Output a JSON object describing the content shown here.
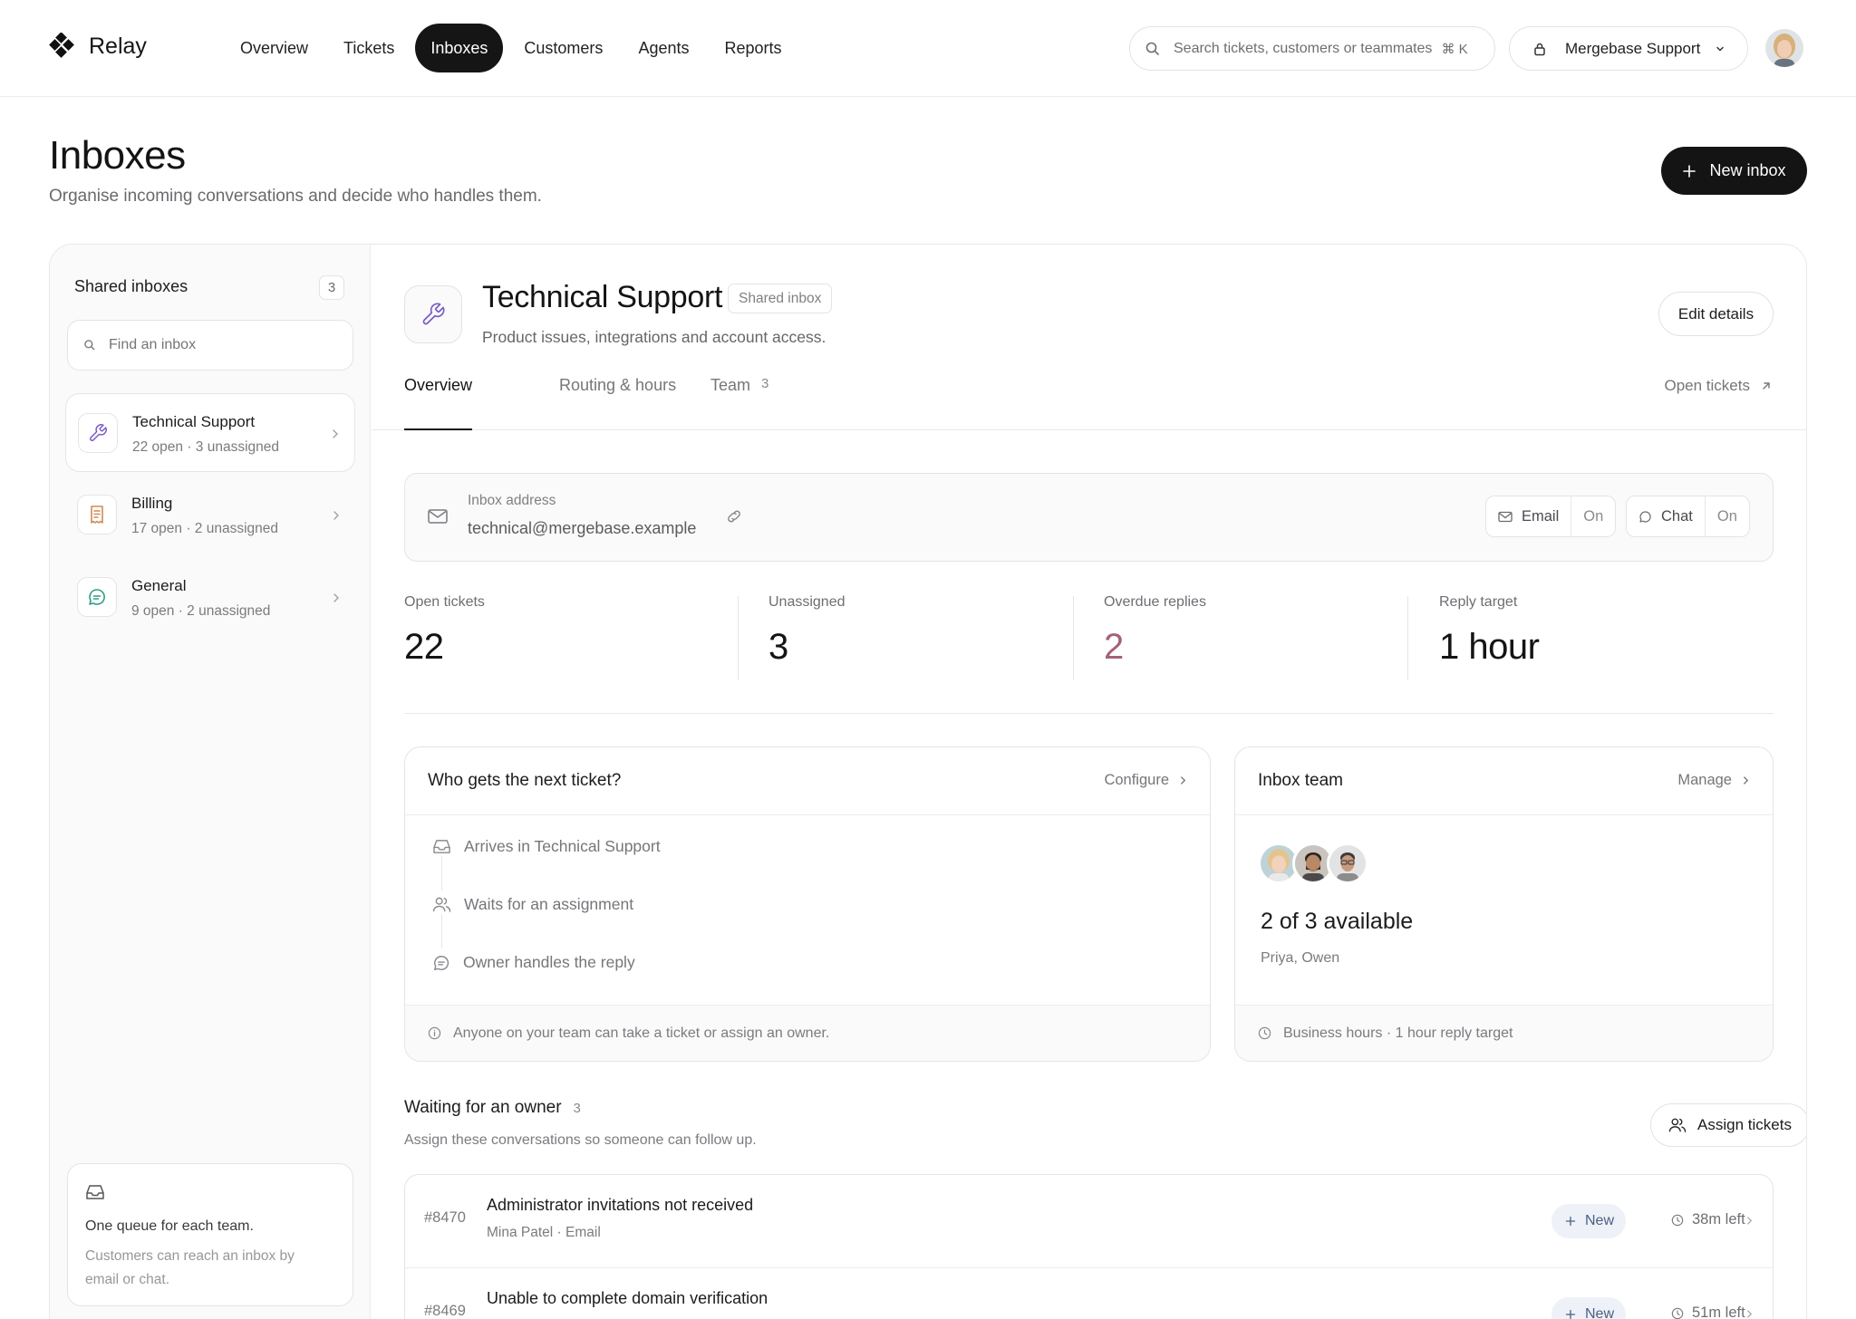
{
  "app": {
    "name": "Relay"
  },
  "nav": {
    "items": [
      {
        "label": "Overview"
      },
      {
        "label": "Tickets"
      },
      {
        "label": "Inboxes",
        "active": true
      },
      {
        "label": "Customers"
      },
      {
        "label": "Agents"
      },
      {
        "label": "Reports"
      }
    ]
  },
  "search": {
    "placeholder": "Search tickets, customers or teammates",
    "shortcut": "⌘ K"
  },
  "workspace": {
    "name": "Mergebase Support"
  },
  "page": {
    "title": "Inboxes",
    "subtitle": "Organise incoming conversations and decide who handles them.",
    "new_button": "New inbox"
  },
  "sidebar": {
    "title": "Shared inboxes",
    "count": "3",
    "search_placeholder": "Find an inbox",
    "items": [
      {
        "name": "Technical Support",
        "meta": "22 open · 3 unassigned",
        "icon": "wrench-icon",
        "selected": true
      },
      {
        "name": "Billing",
        "meta": "17 open · 2 unassigned",
        "icon": "receipt-icon"
      },
      {
        "name": "General",
        "meta": "9 open · 2 unassigned",
        "icon": "chat-bubble-icon"
      }
    ],
    "note": {
      "title": "One queue for each team.",
      "text": "Customers can reach an inbox by email or chat."
    }
  },
  "inbox": {
    "title": "Technical Support",
    "badge": "Shared inbox",
    "description": "Product issues, integrations and account access.",
    "edit_button": "Edit details",
    "tabs": [
      {
        "label": "Overview",
        "active": true
      },
      {
        "label": "Routing & hours"
      },
      {
        "label": "Team",
        "count": "3"
      }
    ],
    "open_tickets_link": "Open tickets",
    "address": {
      "label": "Inbox address",
      "value": "technical@mergebase.example"
    },
    "channels": [
      {
        "name": "Email",
        "state": "On"
      },
      {
        "name": "Chat",
        "state": "On"
      }
    ],
    "stats": [
      {
        "label": "Open tickets",
        "value": "22"
      },
      {
        "label": "Unassigned",
        "value": "3"
      },
      {
        "label": "Overdue replies",
        "value": "2",
        "alert": true
      },
      {
        "label": "Reply target",
        "value": "1 hour"
      }
    ]
  },
  "routing": {
    "title": "Who gets the next ticket?",
    "link": "Configure",
    "steps": [
      {
        "label": "Arrives in Technical Support",
        "icon": "inbox-tray-icon"
      },
      {
        "label": "Waits for an assignment",
        "icon": "users-icon"
      },
      {
        "label": "Owner handles the reply",
        "icon": "chat-bubble-icon"
      }
    ],
    "footer": "Anyone on your team can take a ticket or assign an owner."
  },
  "team": {
    "title": "Inbox team",
    "link": "Manage",
    "availability": "2 of 3 available",
    "names": "Priya, Owen",
    "footer": "Business hours · 1 hour reply target"
  },
  "waiting": {
    "title": "Waiting for an owner",
    "count": "3",
    "description": "Assign these conversations so someone can follow up.",
    "assign_button": "Assign tickets",
    "tickets": [
      {
        "id": "#8470",
        "title": "Administrator invitations not received",
        "meta": "Mina Patel · Email",
        "status": "New",
        "sla": "38m left"
      },
      {
        "id": "#8469",
        "title": "Unable to complete domain verification",
        "meta": "",
        "status": "New",
        "sla": "51m left"
      }
    ]
  },
  "colors": {
    "primary": "#141414",
    "alert": "#a46276",
    "badge_bg": "#eef1f7",
    "badge_fg": "#4b5f85",
    "wrench": "#7c5cc4",
    "receipt": "#d08a52",
    "chat": "#2f9b86"
  }
}
